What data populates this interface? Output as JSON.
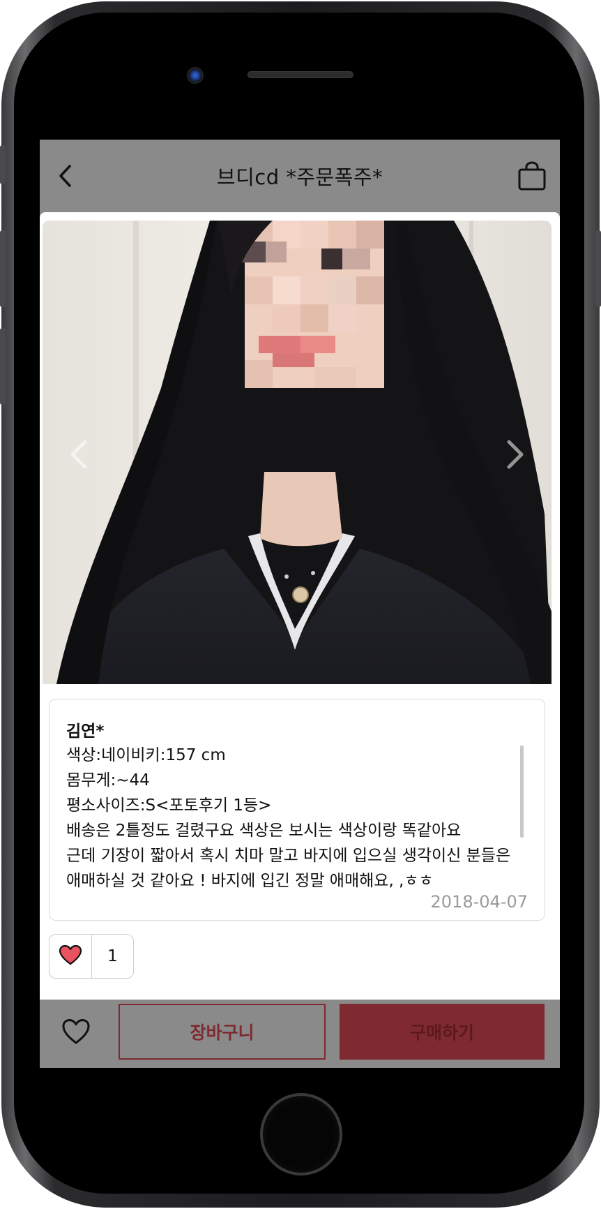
{
  "header": {
    "title": "브디cd *주문폭주*",
    "back_icon": "chevron-left-icon",
    "cart_icon": "shopping-bag-icon"
  },
  "gallery": {
    "prev_icon": "chevron-left-icon",
    "next_icon": "chevron-right-icon",
    "photo": "review-photo"
  },
  "review": {
    "author": "김연*",
    "lines": [
      "색상:네이비키:157 cm",
      "몸무게:~44",
      "평소사이즈:S<포토후기 1등>",
      "배송은 2틀정도 걸렸구요 색상은 보시는 색상이랑 똑같아요",
      "근데 기장이 짧아서 혹시 치마 말고 바지에 입으실 생각이신 분들은",
      "애매하실 것 같아요 ! 바지에 입긴 정말 애매해요, ,ㅎㅎ"
    ],
    "date": "2018-04-07"
  },
  "like": {
    "icon": "heart-icon",
    "count": "1"
  },
  "bottom_bar": {
    "wish_icon": "heart-outline-icon",
    "cart_label": "장바구니",
    "buy_label": "구매하기"
  },
  "colors": {
    "bar_gray": "#8a8a8a",
    "accent": "#7e2a30",
    "heart": "#e8535f"
  }
}
